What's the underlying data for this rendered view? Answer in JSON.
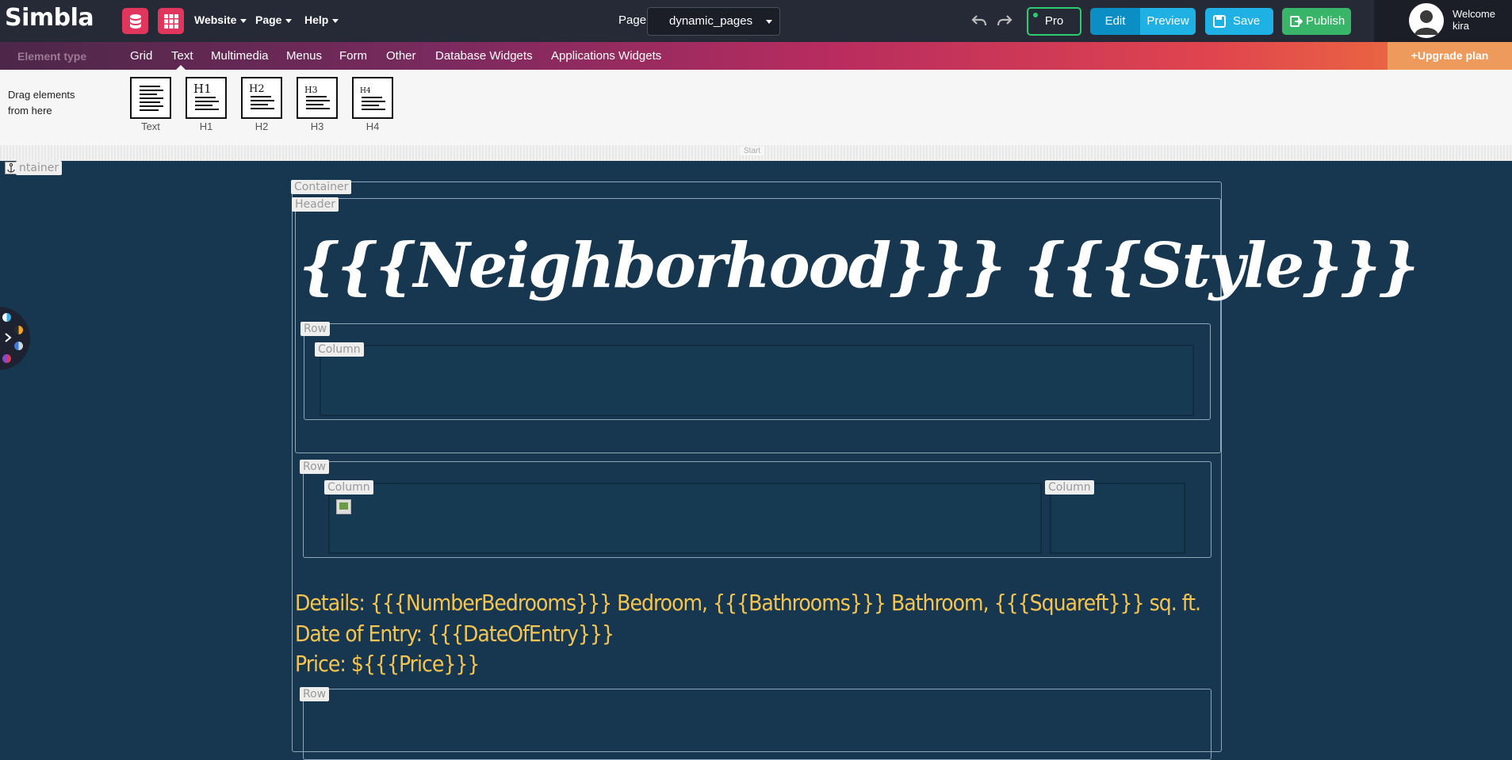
{
  "app": {
    "logo": "Simbla"
  },
  "topbar": {
    "menus": [
      "Website",
      "Page",
      "Help"
    ],
    "page_label": "Page",
    "page_select": "dynamic_pages",
    "pro_label": "Pro",
    "edit_label": "Edit",
    "preview_label": "Preview",
    "save_label": "Save",
    "publish_label": "Publish",
    "welcome_line1": "Welcome",
    "welcome_line2": "kira"
  },
  "elnav": {
    "title": "Element type",
    "tabs": [
      "Grid",
      "Text",
      "Multimedia",
      "Menus",
      "Form",
      "Other",
      "Database Widgets",
      "Applications Widgets"
    ],
    "upgrade_label": "+Upgrade plan"
  },
  "palette": {
    "hint_line1": "Drag elements",
    "hint_line2": "from here",
    "tiles": [
      {
        "label": "Text",
        "heading": ""
      },
      {
        "label": "H1",
        "heading": "H1"
      },
      {
        "label": "H2",
        "heading": "H2"
      },
      {
        "label": "H3",
        "heading": "H3"
      },
      {
        "label": "H4",
        "heading": "H4"
      }
    ],
    "start_marker": "Start"
  },
  "canvas": {
    "tags": {
      "outer_container": "ntainer",
      "container": "Container",
      "header": "Header",
      "row1": "Row",
      "column1": "Column",
      "row2": "Row",
      "column2a": "Column",
      "column2b": "Column",
      "row3": "Row"
    },
    "headline": "{{{Neighborhood}}} {{{Style}}}",
    "details_line1": "Details: {{{NumberBedrooms}}} Bedroom, {{{Bathrooms}}} Bathroom, {{{Squareft}}} sq. ft.",
    "details_line2": "Date of Entry: {{{DateOfEntry}}}",
    "details_line3": "Price: ${{{Price}}}"
  },
  "colors": {
    "accent_red": "#e0365d",
    "edit_blue": "#0a8ec4",
    "preview_blue": "#1fb0e4",
    "publish_green": "#39b56a",
    "canvas_bg": "#16374f",
    "details_yellow": "#f5c451"
  }
}
